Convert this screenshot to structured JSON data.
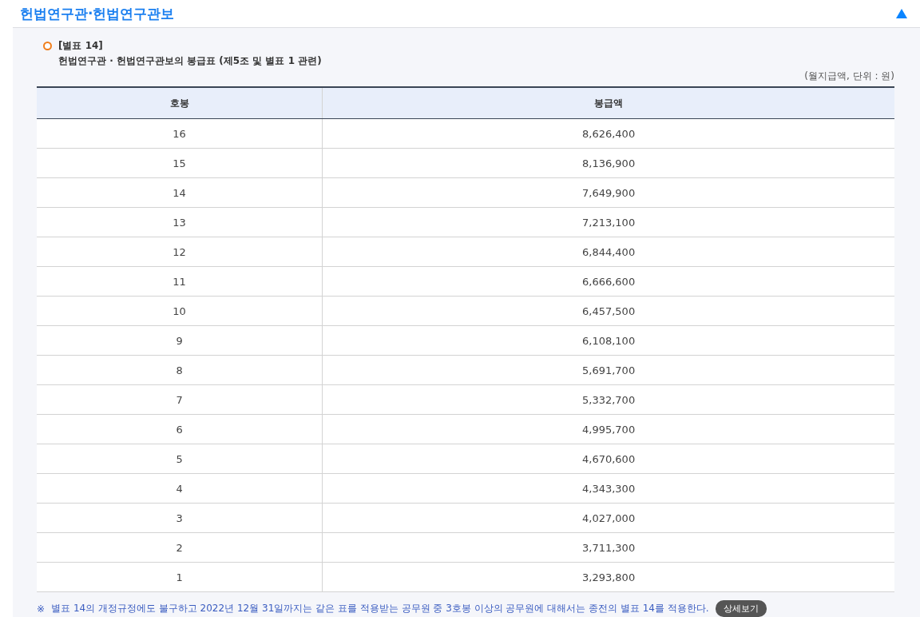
{
  "section": {
    "title": "헌법연구관·헌법연구관보",
    "expanded": true
  },
  "table_block": {
    "label": "[별표 14]",
    "caption": "헌법연구관 · 헌법연구관보의 봉급표 (제5조 및 별표 1 관련)",
    "unit": "(월지급액, 단위 : 원)",
    "columns": [
      "호봉",
      "봉급액"
    ],
    "rows": [
      [
        "16",
        "8,626,400"
      ],
      [
        "15",
        "8,136,900"
      ],
      [
        "14",
        "7,649,900"
      ],
      [
        "13",
        "7,213,100"
      ],
      [
        "12",
        "6,844,400"
      ],
      [
        "11",
        "6,666,600"
      ],
      [
        "10",
        "6,457,500"
      ],
      [
        "9",
        "6,108,100"
      ],
      [
        "8",
        "5,691,700"
      ],
      [
        "7",
        "5,332,700"
      ],
      [
        "6",
        "4,995,700"
      ],
      [
        "5",
        "4,670,600"
      ],
      [
        "4",
        "4,343,300"
      ],
      [
        "3",
        "4,027,000"
      ],
      [
        "2",
        "3,711,300"
      ],
      [
        "1",
        "3,293,800"
      ]
    ],
    "note": {
      "mark": "※",
      "text": "별표 14의 개정규정에도 불구하고 2022년 12월 31일까지는 같은 표를 적용받는 공무원 중 3호봉 이상의 공무원에 대해서는 종전의 별표 14를 적용한다.",
      "button": "상세보기"
    }
  }
}
